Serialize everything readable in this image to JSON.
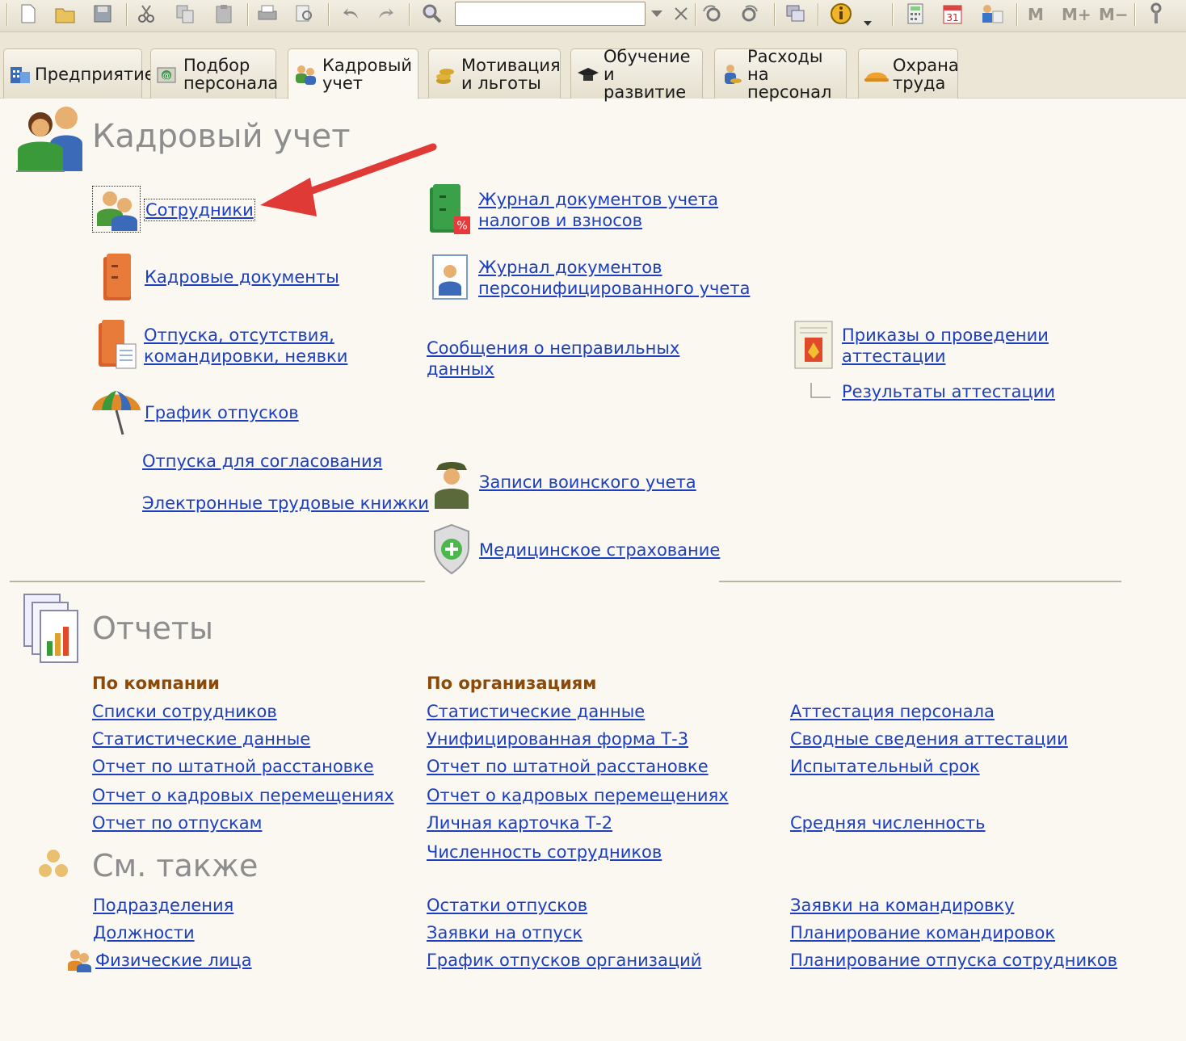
{
  "toolbar": {
    "icons": [
      "new-document-icon",
      "open-folder-icon",
      "save-icon",
      "cut-icon",
      "copy-icon",
      "paste-icon",
      "print-icon",
      "print-preview-icon",
      "undo-icon",
      "redo-icon",
      "find-icon",
      "search-dropdown-icon",
      "search-clear-icon",
      "search-next-icon",
      "search-prev-icon",
      "windows-icon",
      "info-icon",
      "calculator-icon",
      "calendar-icon",
      "users-icon",
      "settings-icon"
    ],
    "search_value": "",
    "calendar_day": "31",
    "memory_buttons": [
      "M",
      "M+",
      "M−"
    ]
  },
  "tabs": [
    {
      "line1": "Предприятие",
      "line2": ""
    },
    {
      "line1": "Подбор",
      "line2": "персонала"
    },
    {
      "line1": "Кадровый",
      "line2": "учет"
    },
    {
      "line1": "Мотивация",
      "line2": "и льготы"
    },
    {
      "line1": "Обучение и",
      "line2": "развитие"
    },
    {
      "line1": "Расходы на",
      "line2": "персонал"
    },
    {
      "line1": "Охрана",
      "line2": "труда"
    }
  ],
  "hr_section": {
    "title": "Кадровый учет",
    "links": {
      "employees": "Сотрудники",
      "hr_docs": "Кадровые документы",
      "absences_1": "Отпуска, отсутствия,",
      "absences_2": "командировки, неявки",
      "vacation_schedule": "График отпусков",
      "vacations_approval": "Отпуска для согласования",
      "e_workbooks": "Электронные трудовые книжки",
      "tax_journal_1": "Журнал документов учета",
      "tax_journal_2": "налогов и взносов",
      "personal_journal_1": "Журнал документов",
      "personal_journal_2": "персонифицированного учета",
      "wrong_data_1": "Сообщения о неправильных",
      "wrong_data_2": "данных",
      "military": "Записи воинского учета",
      "medical": "Медицинское страхование",
      "attestation_orders_1": "Приказы о проведении",
      "attestation_orders_2": "аттестации",
      "attestation_results": "Результаты аттестации"
    }
  },
  "reports": {
    "title": "Отчеты",
    "col1_header": "По компании",
    "col2_header": "По организациям",
    "col1": [
      "Списки сотрудников",
      "Статистические данные",
      "Отчет по штатной расстановке",
      "Отчет о кадровых перемещениях",
      "Отчет по отпускам"
    ],
    "col2": [
      "Статистические данные ",
      "Унифицированная форма Т-3",
      "Отчет по штатной расстановке",
      "Отчет о кадровых перемещениях",
      "Личная карточка Т-2",
      "Численность сотрудников"
    ],
    "col3": [
      "Аттестация персонала",
      "Сводные сведения аттестации",
      "Испытательный срок",
      "Средняя численность"
    ]
  },
  "see_also": {
    "title": "См. также",
    "col1": [
      "Подразделения",
      "Должности",
      "Физические лица"
    ],
    "col2": [
      "Остатки отпусков",
      "Заявки на отпуск",
      "График отпусков организаций"
    ],
    "col3": [
      "Заявки на командировку",
      "Планирование командировок",
      "Планирование отпуска сотрудников"
    ]
  },
  "colors": {
    "link": "#1b3fbf",
    "header": "#8b4a08",
    "title": "#8d8d8d",
    "arrow": "#e03a36"
  }
}
